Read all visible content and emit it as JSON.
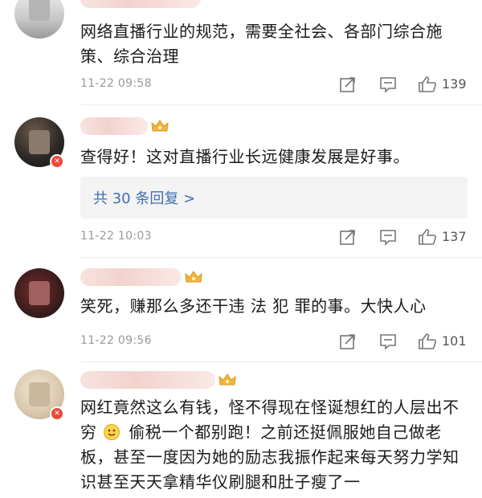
{
  "comments": [
    {
      "text": "网络直播行业的规范，需要全社会、各部门综合施策、综合治理",
      "time": "11-22 09:58",
      "likes": "139"
    },
    {
      "text": "查得好！这对直播行业长远健康发展是好事。",
      "replies": "共 30 条回复 >",
      "time": "11-22 10:03",
      "likes": "137"
    },
    {
      "text": "笑死，赚那么多还干违 法 犯 罪的事。大快人心",
      "time": "11-22 09:56",
      "likes": "101"
    },
    {
      "text_part1": "网红竟然这么有钱，怪不得现在怪诞想红的人层出不穷",
      "text_part2": "偷税一个都别跑！之前还挺佩服她自己做老板，甚至一度因为她的励志我振作起来每天努力学知识甚至天天拿精华仪刷腿和肚子瘦了一"
    }
  ],
  "icons": {
    "share": "share-icon",
    "comment": "comment-icon",
    "like": "thumbs-up-icon",
    "vip": "crown-icon",
    "emoji": "smile-emoji-icon"
  },
  "colors": {
    "link": "#3e6fb5",
    "meta": "#9a9a9a",
    "vip_gold": "#f2b53a"
  }
}
